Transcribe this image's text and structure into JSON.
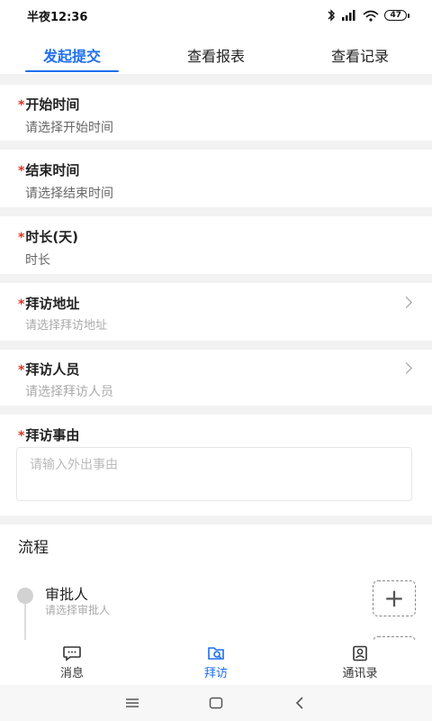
{
  "status_bar": {
    "time": "半夜12:36",
    "battery": "47"
  },
  "tabs": [
    {
      "label": "发起提交",
      "active": true
    },
    {
      "label": "查看报表",
      "active": false
    },
    {
      "label": "查看记录",
      "active": false
    }
  ],
  "form": {
    "required_mark": "*",
    "start_time": {
      "label": "开始时间",
      "placeholder": "请选择开始时间"
    },
    "end_time": {
      "label": "结束时间",
      "placeholder": "请选择结束时间"
    },
    "duration": {
      "label": "时长(天)",
      "value": "时长"
    },
    "visit_address": {
      "label": "拜访地址",
      "placeholder": "请选择拜访地址"
    },
    "visit_person": {
      "label": "拜访人员",
      "placeholder": "请选择拜访人员"
    },
    "visit_reason": {
      "label": "拜访事由",
      "placeholder": "请输入外出事由"
    }
  },
  "flow": {
    "title": "流程",
    "approver_label": "审批人",
    "approver_placeholder": "请选择审批人",
    "add_symbol": "+"
  },
  "bottom_nav": [
    {
      "label": "消息",
      "icon": "message-icon",
      "active": false
    },
    {
      "label": "拜访",
      "icon": "visit-icon",
      "active": true
    },
    {
      "label": "通讯录",
      "icon": "contacts-icon",
      "active": false
    }
  ],
  "colors": {
    "accent": "#1e6ff0",
    "required": "#e0301e",
    "divider": "#f2f2f2"
  }
}
